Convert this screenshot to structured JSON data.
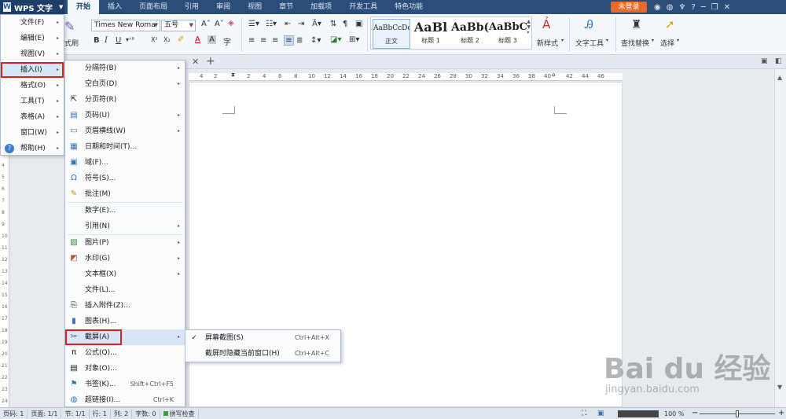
{
  "app": {
    "title": "WPS 文字",
    "login_label": "未登录"
  },
  "tabs": [
    "开始",
    "插入",
    "页面布局",
    "引用",
    "审阅",
    "视图",
    "章节",
    "加载项",
    "开发工具",
    "特色功能"
  ],
  "ribbon": {
    "format_painter": "式刷",
    "font_name": "Times New Roma",
    "font_size": "五号",
    "bold": "B",
    "italic": "I",
    "underline": "U",
    "styles": [
      {
        "sample": "AaBbCcDc",
        "name": "正文"
      },
      {
        "sample": "AaBl",
        "name": "标题 1"
      },
      {
        "sample": "AaBb(",
        "name": "标题 2"
      },
      {
        "sample": "AaBbC",
        "name": "标题 3"
      }
    ],
    "new_style": "新样式",
    "text_tools": "文字工具",
    "find_replace": "查找替换",
    "select": "选择"
  },
  "ruler_numbers": [
    "4",
    "2",
    "2",
    "4",
    "6",
    "8",
    "10",
    "12",
    "14",
    "16",
    "18",
    "20",
    "22",
    "24",
    "26",
    "28",
    "30",
    "32",
    "34",
    "36",
    "38",
    "40",
    "42",
    "44",
    "46"
  ],
  "vruler_numbers": [
    "3",
    "4",
    "5",
    "6",
    "7",
    "8",
    "9",
    "10",
    "11",
    "12",
    "13",
    "14",
    "15",
    "16",
    "17",
    "18",
    "19",
    "20",
    "21",
    "22",
    "23",
    "24"
  ],
  "main_menu": [
    {
      "label": "文件(F)"
    },
    {
      "label": "编辑(E)"
    },
    {
      "label": "视图(V)"
    },
    {
      "label": "插入(I)"
    },
    {
      "label": "格式(O)"
    },
    {
      "label": "工具(T)"
    },
    {
      "label": "表格(A)"
    },
    {
      "label": "窗口(W)"
    },
    {
      "label": "帮助(H)"
    }
  ],
  "insert_menu": [
    {
      "label": "分隔符(B)",
      "icon": "",
      "arrow": true
    },
    {
      "label": "空白页(D)",
      "icon": "",
      "arrow": true
    },
    {
      "label": "分页符(R)",
      "icon": "⇱"
    },
    {
      "label": "页码(U)",
      "icon": "▤",
      "arrow": true
    },
    {
      "label": "页眉横线(W)",
      "icon": "▭",
      "arrow": true
    },
    {
      "label": "日期和时间(T)...",
      "icon": "▦"
    },
    {
      "label": "域(F)...",
      "icon": "▣"
    },
    {
      "label": "符号(S)...",
      "icon": "Ω"
    },
    {
      "label": "批注(M)",
      "icon": "✎"
    },
    {
      "label": "数字(E)...",
      "icon": "",
      "sep_before": true
    },
    {
      "label": "引用(N)",
      "icon": "",
      "arrow": true
    },
    {
      "label": "图片(P)",
      "icon": "▨",
      "arrow": true,
      "sep_before": true
    },
    {
      "label": "水印(G)",
      "icon": "◩",
      "arrow": true
    },
    {
      "label": "文本框(X)",
      "icon": "",
      "arrow": true
    },
    {
      "label": "文件(L)...",
      "icon": ""
    },
    {
      "label": "插入附件(Z)...",
      "icon": "⎘"
    },
    {
      "label": "图表(H)...",
      "icon": "▮"
    },
    {
      "label": "截屏(A)",
      "icon": "✂",
      "arrow": true
    },
    {
      "label": "公式(Q)...",
      "icon": "π"
    },
    {
      "label": "对象(O)...",
      "icon": "▤"
    },
    {
      "label": "书签(K)...",
      "icon": "⚑",
      "shortcut": "Shift+Ctrl+F5"
    },
    {
      "label": "超链接(I)...",
      "icon": "◍",
      "shortcut": "Ctrl+K"
    }
  ],
  "screenshot_submenu": [
    {
      "label": "屏幕截图(S)",
      "shortcut": "Ctrl+Alt+X",
      "checked": true
    },
    {
      "label": "截屏时隐藏当前窗口(H)",
      "shortcut": "Ctrl+Alt+C"
    }
  ],
  "status": {
    "page_num": "页码: 1",
    "pages": "页面: 1/1",
    "section": "节: 1/1",
    "line": "行: 1",
    "col": "列: 2",
    "words": "字数: 0",
    "spell": "拼写检查",
    "zoom": "100 %"
  },
  "watermark": {
    "big": "Bai du 经验",
    "small": "jingyan.baidu.com"
  }
}
